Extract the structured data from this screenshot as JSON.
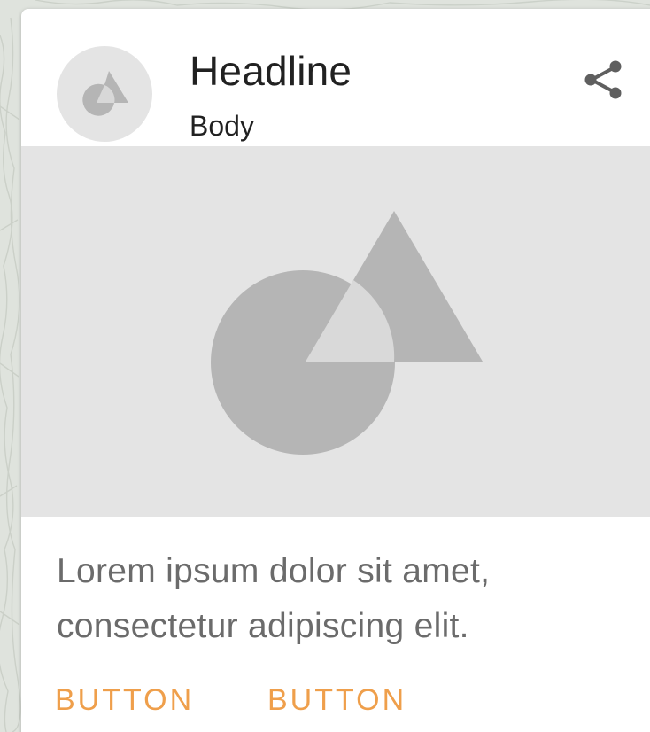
{
  "card": {
    "headline": "Headline",
    "body": "Body",
    "supporting_text": "Lorem ipsum dolor sit amet, consectetur adipiscing elit.",
    "actions": [
      {
        "label": "BUTTON"
      },
      {
        "label": "BUTTON"
      }
    ]
  },
  "icons": {
    "share": "share-icon",
    "avatar": "image-placeholder-icon",
    "media": "image-placeholder-icon"
  },
  "colors": {
    "accent": "#ef9f4b",
    "headline": "#212121",
    "supporting_text": "#6b6b6b",
    "placeholder_bg": "#e4e4e4",
    "placeholder_shape": "#b5b5b5",
    "card_bg": "#ffffff"
  }
}
